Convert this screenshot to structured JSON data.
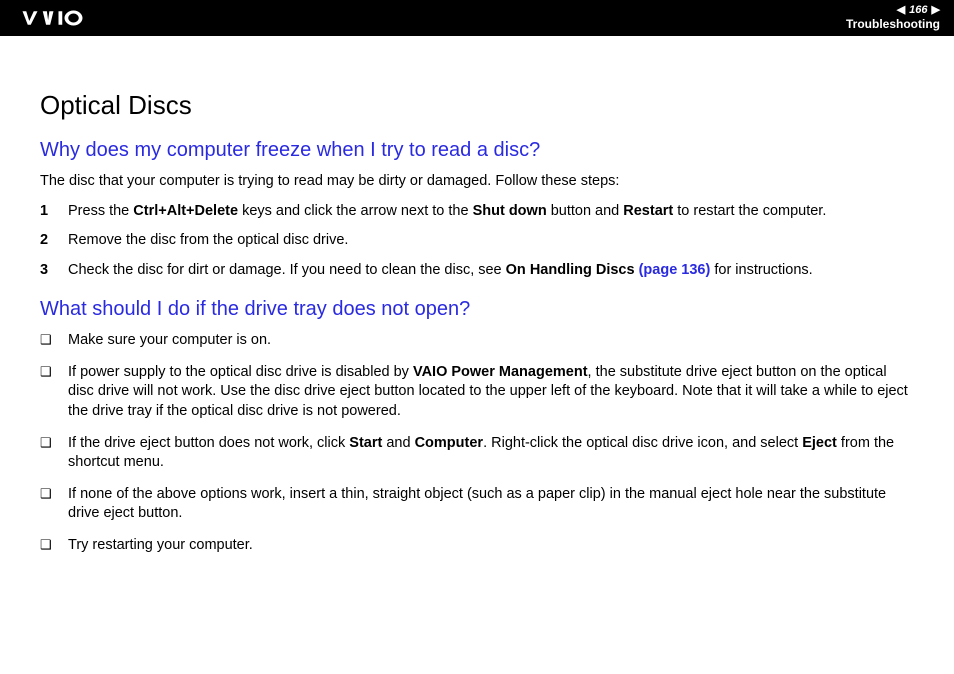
{
  "header": {
    "page_number": "166",
    "section": "Troubleshooting"
  },
  "topic_title": "Optical Discs",
  "q1": {
    "heading": "Why does my computer freeze when I try to read a disc?",
    "intro": "The disc that your computer is trying to read may be dirty or damaged. Follow these steps:",
    "step1_a": "Press the ",
    "step1_b": "Ctrl+Alt+Delete",
    "step1_c": " keys and click the arrow next to the ",
    "step1_d": "Shut down",
    "step1_e": " button and ",
    "step1_f": "Restart",
    "step1_g": " to restart the computer.",
    "step2": "Remove the disc from the optical disc drive.",
    "step3_a": "Check the disc for dirt or damage. If you need to clean the disc, see ",
    "step3_b": "On Handling Discs",
    "step3_c": " (page 136)",
    "step3_d": " for instructions."
  },
  "q2": {
    "heading": "What should I do if the drive tray does not open?",
    "b1": "Make sure your computer is on.",
    "b2_a": "If power supply to the optical disc drive is disabled by ",
    "b2_b": "VAIO Power Management",
    "b2_c": ", the substitute drive eject button on the optical disc drive will not work. Use the disc drive eject button located to the upper left of the keyboard. Note that it will take a while to eject the drive tray if the optical disc drive is not powered.",
    "b3_a": "If the drive eject button does not work, click ",
    "b3_b": "Start",
    "b3_c": " and ",
    "b3_d": "Computer",
    "b3_e": ". Right-click the optical disc drive icon, and select ",
    "b3_f": "Eject",
    "b3_g": " from the shortcut menu.",
    "b4": "If none of the above options work, insert a thin, straight object (such as a paper clip) in the manual eject hole near the substitute drive eject button.",
    "b5": "Try restarting your computer."
  }
}
